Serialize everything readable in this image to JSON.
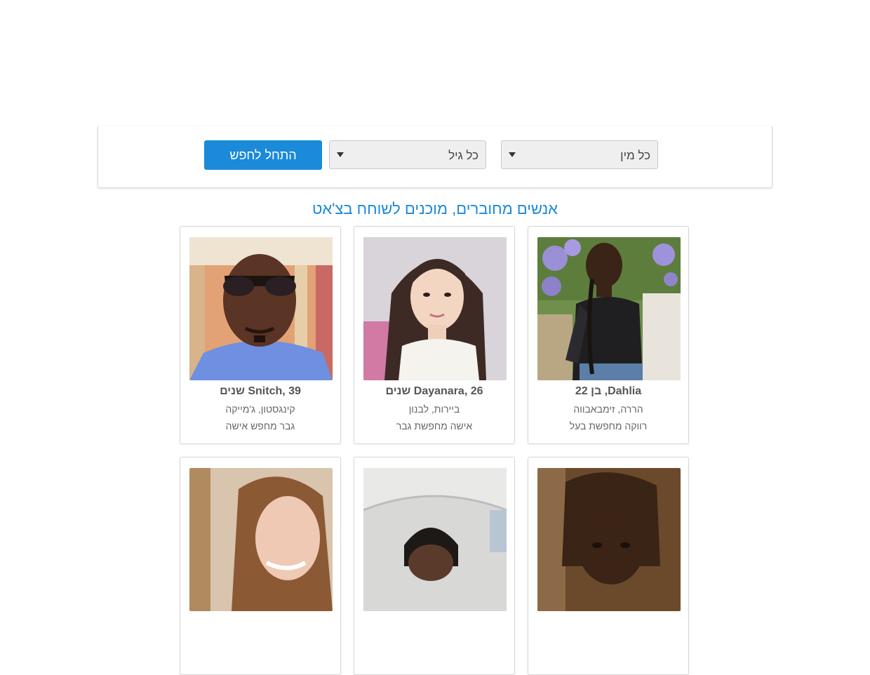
{
  "search": {
    "button_label": "התחל לחפש",
    "age_select": "כל גיל",
    "gender_select": "כל מין"
  },
  "section": {
    "title": "אנשים מחוברים, מוכנים לשוחח בצ'אט"
  },
  "profiles": [
    {
      "name": "Dahlia, בן 22",
      "location": "הררה, זימבאבווה",
      "seeking": "רווקה מחפשת בעל"
    },
    {
      "name": "Dayanara, 26 שנים",
      "location": "ביירות, לבנון",
      "seeking": "אישה מחפשת גבר"
    },
    {
      "name": "Snitch, 39 שנים",
      "location": "קינגסטון, ג'מייקה",
      "seeking": "גבר מחפש אישה"
    },
    {
      "name": "",
      "location": "",
      "seeking": ""
    },
    {
      "name": "",
      "location": "",
      "seeking": ""
    },
    {
      "name": "",
      "location": "",
      "seeking": ""
    }
  ],
  "icons": {
    "dropdown": "caret-down-icon"
  },
  "colors": {
    "accent": "#1a8ad9"
  }
}
